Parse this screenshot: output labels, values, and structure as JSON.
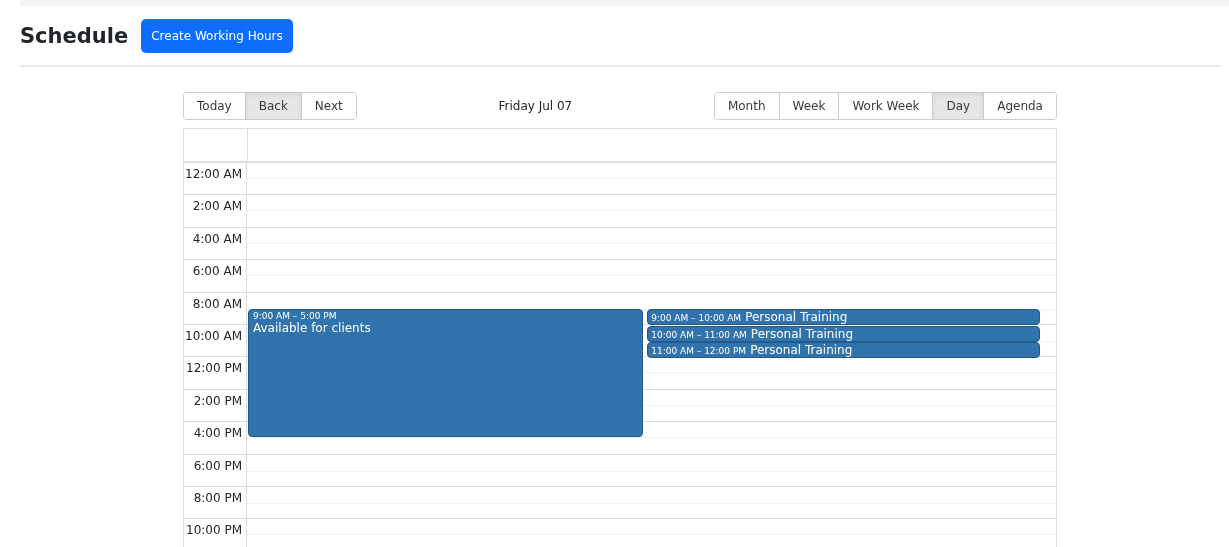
{
  "header": {
    "title": "Schedule",
    "button": "Create Working Hours"
  },
  "navigation": [
    {
      "label": "Today",
      "selected": false
    },
    {
      "label": "Back",
      "selected": true
    },
    {
      "label": "Next",
      "selected": false
    }
  ],
  "date_label": "Friday Jul 07",
  "views": [
    {
      "label": "Month",
      "selected": false
    },
    {
      "label": "Week",
      "selected": false
    },
    {
      "label": "Work Week",
      "selected": false
    },
    {
      "label": "Day",
      "selected": true
    },
    {
      "label": "Agenda",
      "selected": false
    }
  ],
  "time_slots": [
    "12:00 AM",
    "2:00 AM",
    "4:00 AM",
    "6:00 AM",
    "8:00 AM",
    "10:00 AM",
    "12:00 PM",
    "2:00 PM",
    "4:00 PM",
    "6:00 PM",
    "8:00 PM",
    "10:00 PM"
  ],
  "events": [
    {
      "time": "9:00 AM – 5:00 PM",
      "title": "Available for clients"
    },
    {
      "time": "9:00 AM – 10:00 AM",
      "title": "Personal Training"
    },
    {
      "time": "10:00 AM – 11:00 AM",
      "title": "Personal Training"
    },
    {
      "time": "11:00 AM – 12:00 PM",
      "title": "Personal Training"
    }
  ]
}
